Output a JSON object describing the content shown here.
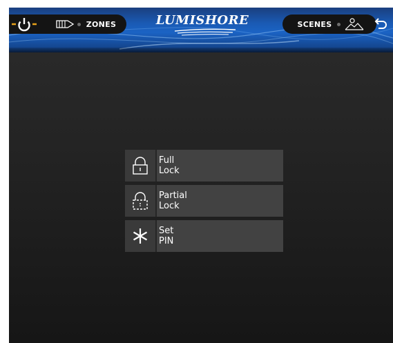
{
  "header": {
    "zones_label": "ZONES",
    "scenes_label": "SCENES",
    "logo_text": "LUMISHORE"
  },
  "menu": {
    "items": [
      {
        "line1": "Full",
        "line2": "Lock",
        "icon": "lock-icon"
      },
      {
        "line1": "Partial",
        "line2": "Lock",
        "icon": "partial-lock-icon"
      },
      {
        "line1": "Set",
        "line2": "PIN",
        "icon": "asterisk-icon"
      }
    ]
  },
  "colors": {
    "accent_power": "#e8a21a",
    "header_blue": "#1b63c4",
    "background": "#232323",
    "button": "#424242"
  }
}
